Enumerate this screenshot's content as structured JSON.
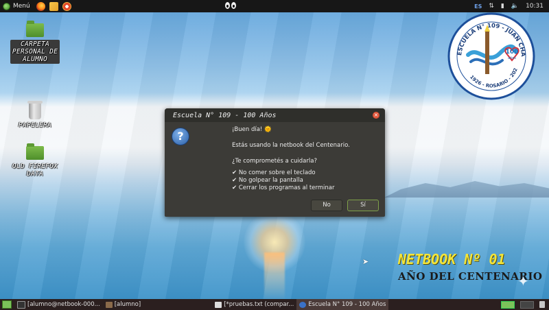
{
  "top_panel": {
    "menu_label": "Menú",
    "keyboard_layout": "ES",
    "clock": "10:31"
  },
  "desktop": {
    "icons": [
      {
        "label_line1": "CARPETA",
        "label_line2": "PERSONAL DE",
        "label_line3": "ALUMNO"
      },
      {
        "label_line1": "PAPELERA"
      },
      {
        "label_line1": "OLD FIREFOX",
        "label_line2": "DATA"
      }
    ],
    "logo": {
      "ring_text": "ESCUELA N° 109 - JUAN CHASSAING",
      "years_text": "1926 - ROSARIO - 2026",
      "anniversary": "100",
      "anniversary_sub": "años"
    },
    "wallpaper_title": "NETBOOK Nº 01",
    "wallpaper_subtitle": "AÑO DEL CENTENARIO"
  },
  "dialog": {
    "title": "Escuela N° 109 - 100 Años",
    "greeting": "¡Buen día! 🌞",
    "line1": "Estás usando la netbook del Centenario.",
    "question": "¿Te comprometés a cuidarla?",
    "rules": [
      "✔ No comer sobre el teclado",
      "✔ No golpear la pantalla",
      "✔ Cerrar los programas al terminar"
    ],
    "no_label": "No",
    "yes_label": "Sí"
  },
  "taskbar": {
    "items": [
      {
        "label": "[alumno@netbook-000..."
      },
      {
        "label": "[alumno]"
      },
      {
        "label": "[*pruebas.txt (compar..."
      },
      {
        "label": "Escuela N° 109 - 100 Años"
      }
    ]
  }
}
